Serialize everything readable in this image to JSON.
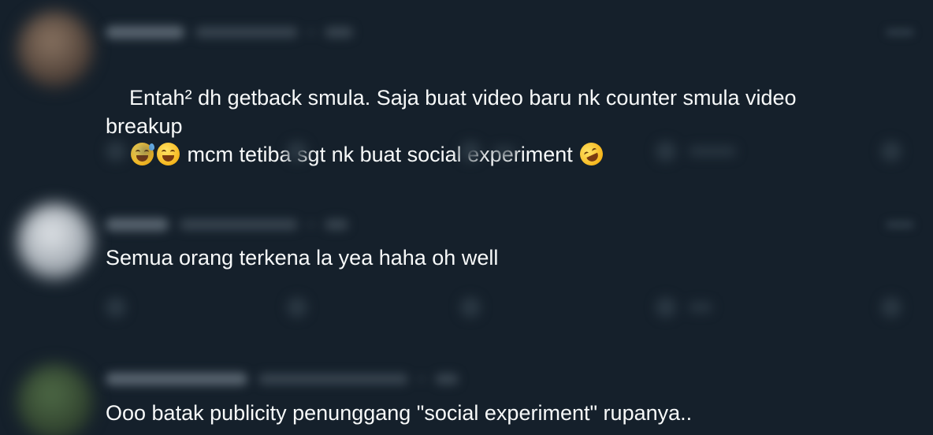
{
  "theme": {
    "background": "#15202b",
    "text_color": "#f7f9f9",
    "blur_color": "#5a6671"
  },
  "replies": [
    {
      "text_lines": [
        "Entah² dh getback smula. Saja buat video baru nk counter smula video",
        "breakup",
        " mcm tetiba sgt nk buat social experiment "
      ],
      "emojis": [
        "grinning-face-with-sweat-icon",
        "grinning-squinting-face-icon",
        "rolling-on-floor-laughing-icon"
      ],
      "avatar_color": "#6d5a4e"
    },
    {
      "text": "Semua orang terkena la yea haha oh well",
      "avatar_color": "#aab0b8"
    },
    {
      "text": "Ooo batak publicity penunggang \"social experiment\" rupanya..",
      "avatar_color": "#3f5a3a"
    }
  ]
}
